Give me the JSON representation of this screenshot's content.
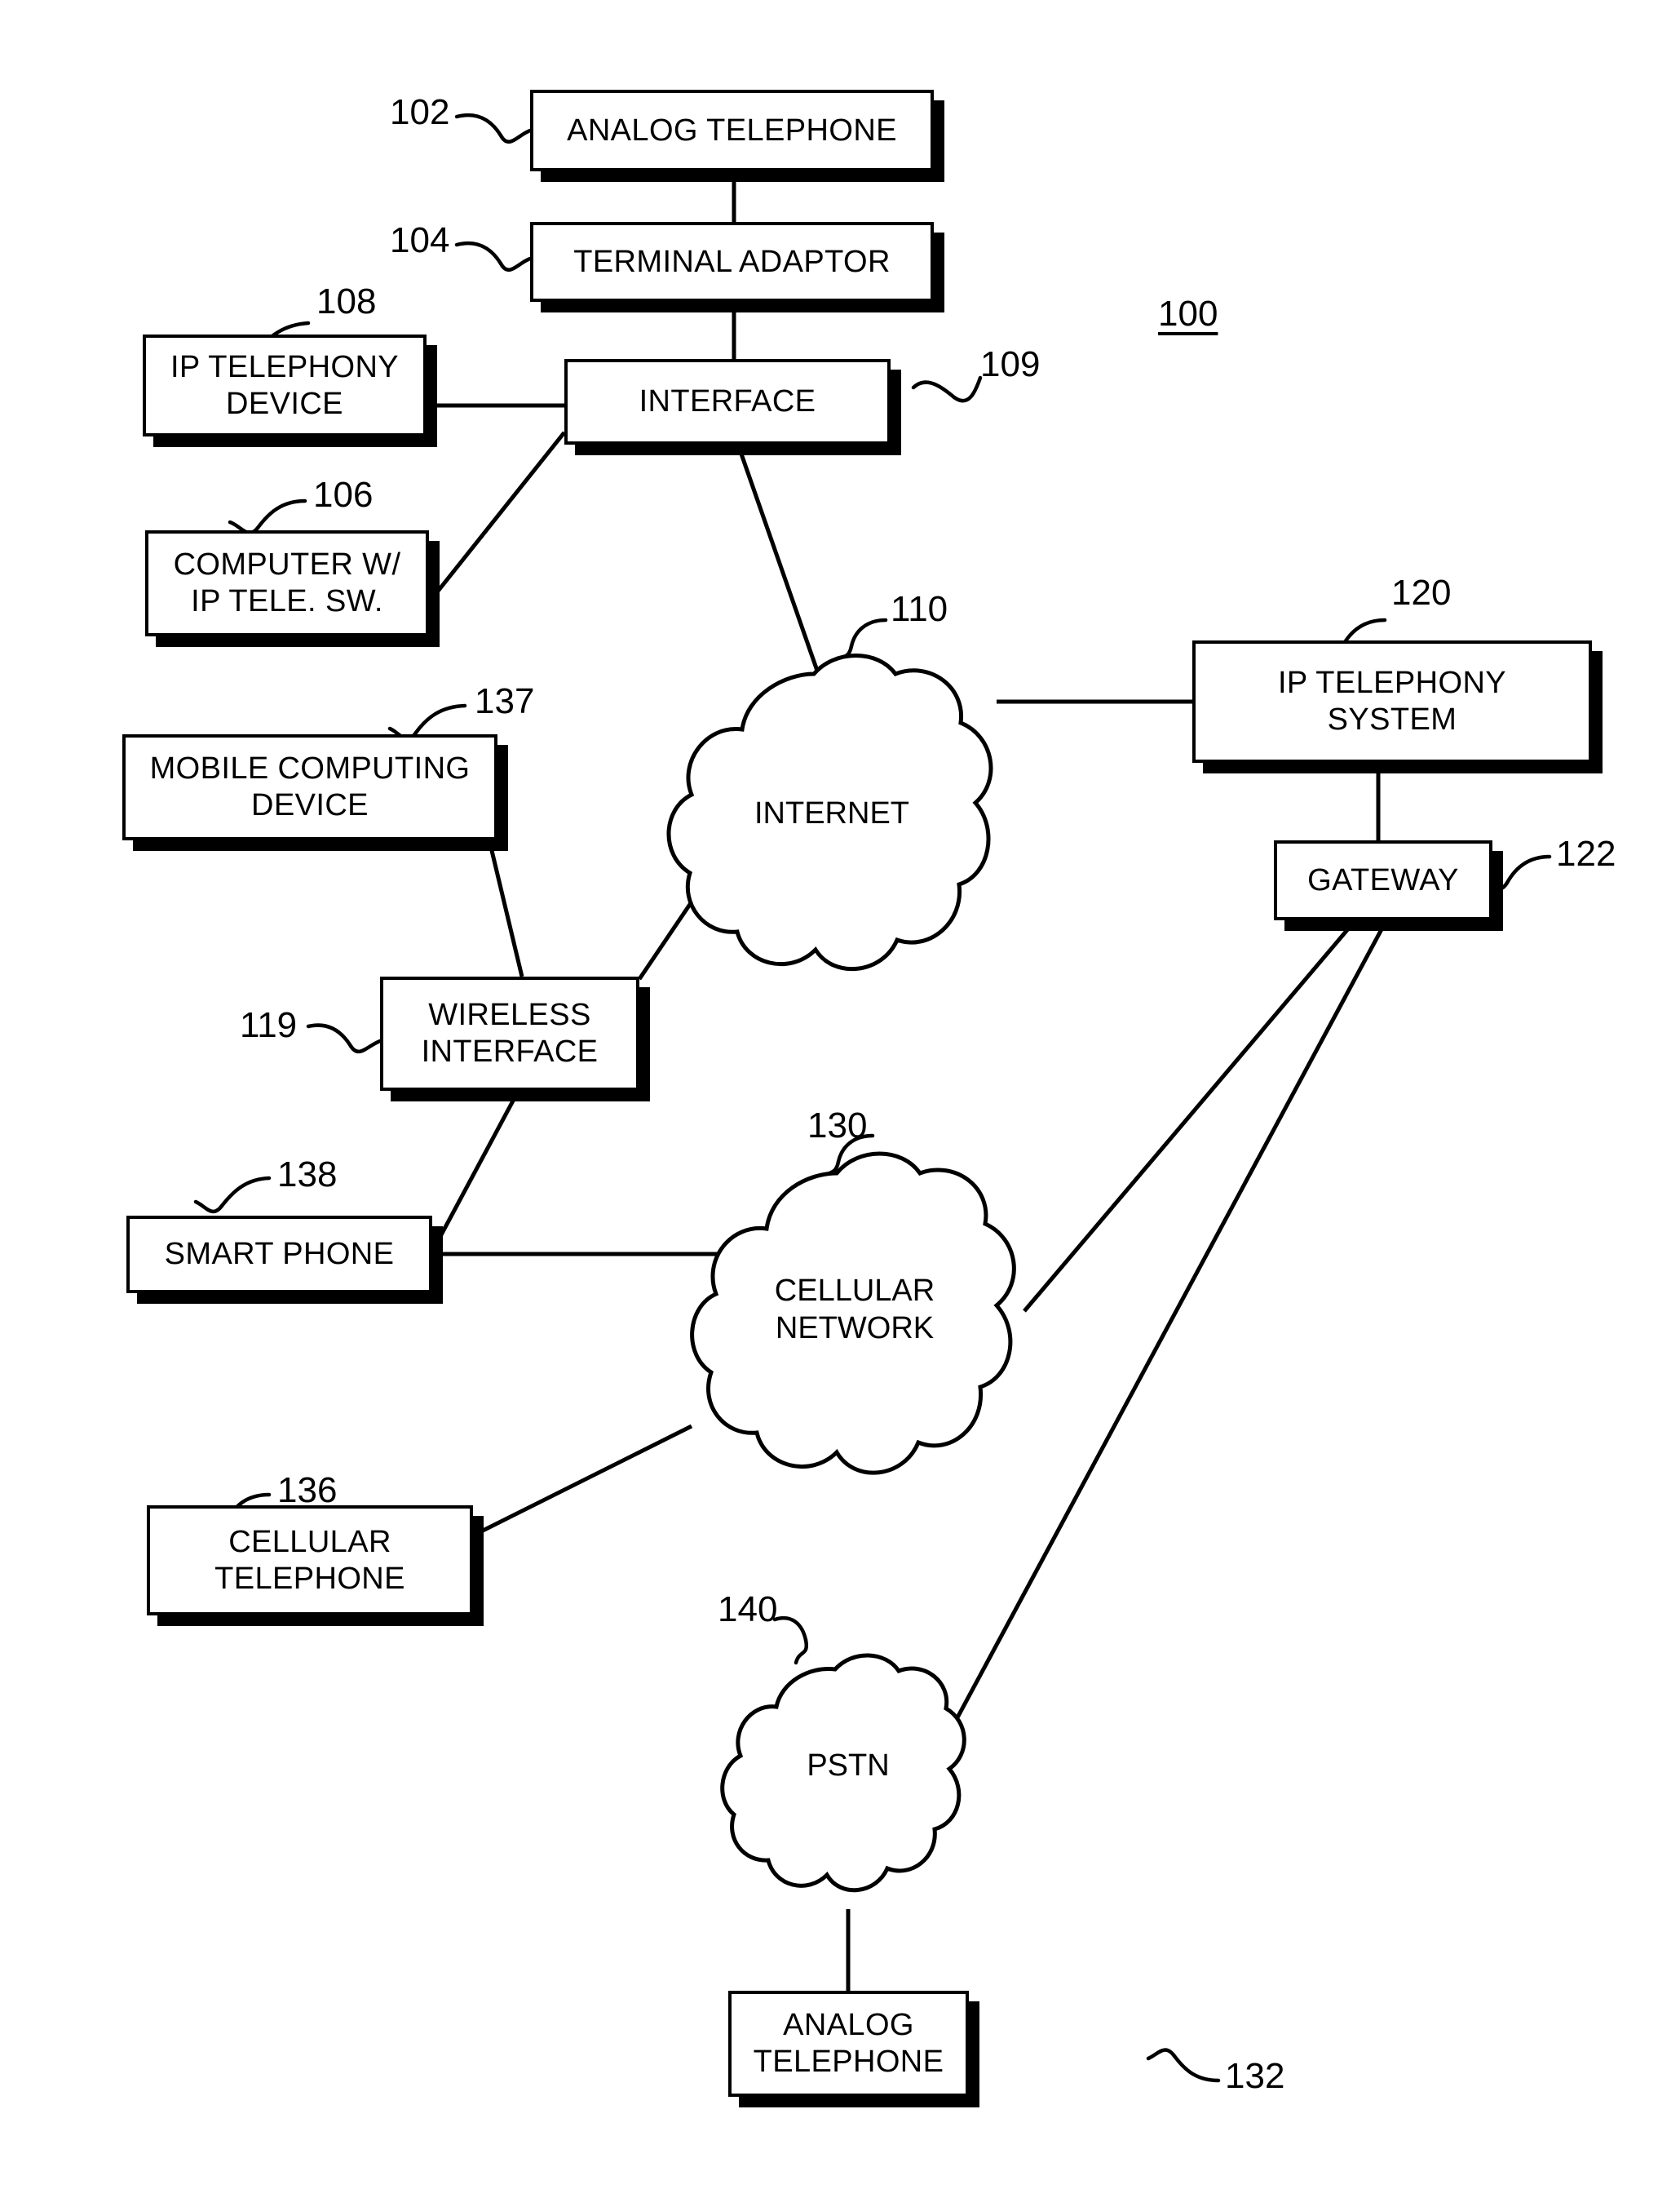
{
  "figure": {
    "figure_number": "100",
    "nodes": [
      {
        "id": "analog_telephone_top",
        "label": "ANALOG TELEPHONE",
        "ref": "102"
      },
      {
        "id": "terminal_adaptor",
        "label": "TERMINAL ADAPTOR",
        "ref": "104"
      },
      {
        "id": "ip_telephony_device",
        "label": "IP TELEPHONY\nDEVICE",
        "ref": "108"
      },
      {
        "id": "interface",
        "label": "INTERFACE",
        "ref": "109"
      },
      {
        "id": "computer_ip_sw",
        "label": "COMPUTER W/\nIP TELE. SW.",
        "ref": "106"
      },
      {
        "id": "mobile_computing",
        "label": "MOBILE COMPUTING\nDEVICE",
        "ref": "137"
      },
      {
        "id": "wireless_interface",
        "label": "WIRELESS\nINTERFACE",
        "ref": "119"
      },
      {
        "id": "smart_phone",
        "label": "SMART PHONE",
        "ref": "138"
      },
      {
        "id": "cellular_telephone",
        "label": "CELLULAR\nTELEPHONE",
        "ref": "136"
      },
      {
        "id": "ip_telephony_system",
        "label": "IP TELEPHONY\nSYSTEM",
        "ref": "120"
      },
      {
        "id": "gateway",
        "label": "GATEWAY",
        "ref": "122"
      },
      {
        "id": "analog_telephone_bottom",
        "label": "ANALOG\nTELEPHONE",
        "ref": "132"
      }
    ],
    "clouds": [
      {
        "id": "internet",
        "label": "INTERNET",
        "ref": "110"
      },
      {
        "id": "cellular_network",
        "label": "CELLULAR\nNETWORK",
        "ref": "130"
      },
      {
        "id": "pstn",
        "label": "PSTN",
        "ref": "140"
      }
    ],
    "colors": {
      "stroke": "#000000",
      "background": "#ffffff",
      "shadow": "#000000"
    }
  }
}
